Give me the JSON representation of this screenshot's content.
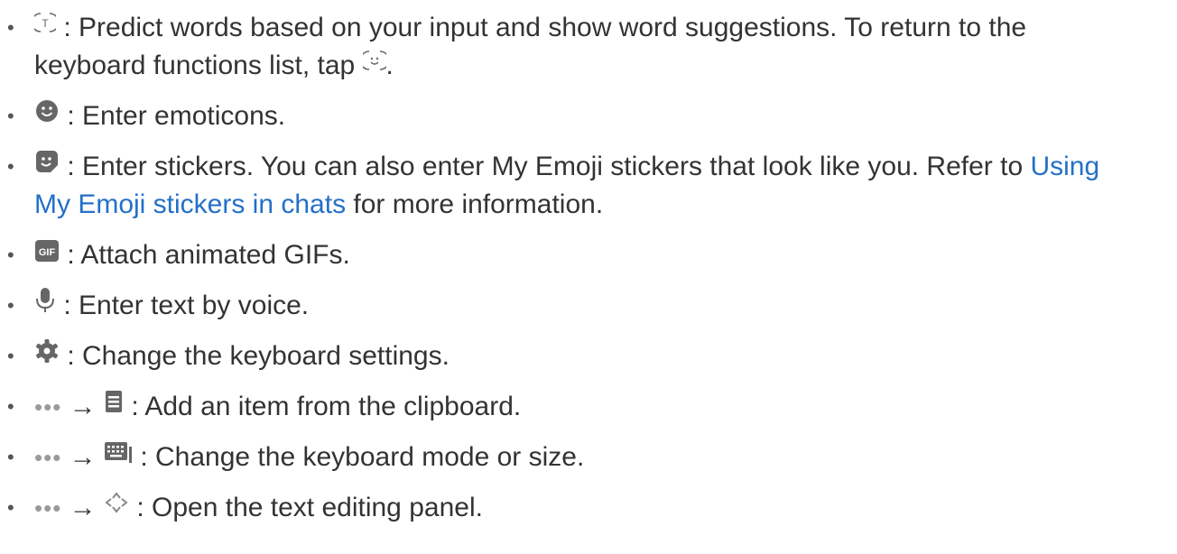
{
  "items": [
    {
      "key": "predict",
      "icon": "predictive-text-icon",
      "line1": ": Predict words based on your input and show word suggestions. To return to the",
      "line2_prefix": "keyboard functions list, tap ",
      "line2_suffix": ".",
      "tap_icon": "emoji-keyboard-return-icon"
    },
    {
      "key": "emoticons",
      "icon": "smiley-icon",
      "text": ": Enter emoticons."
    },
    {
      "key": "stickers",
      "icon": "sticker-icon",
      "text": ": Enter stickers. You can also enter My Emoji stickers that look like you. Refer to ",
      "link_a": "Using",
      "link_b": "My Emoji stickers in chats",
      "after": " for more information."
    },
    {
      "key": "gif",
      "icon": "gif-icon",
      "gif_label": "GIF",
      "text": ": Attach animated GIFs."
    },
    {
      "key": "voice",
      "icon": "microphone-icon",
      "text": ": Enter text by voice."
    },
    {
      "key": "settings",
      "icon": "gear-icon",
      "text": ": Change the keyboard settings."
    },
    {
      "key": "clipboard",
      "more": "•••",
      "arrow": "→",
      "icon": "clipboard-icon",
      "text": ": Add an item from the clipboard."
    },
    {
      "key": "mode",
      "more": "•••",
      "arrow": "→",
      "icon": "keyboard-mode-icon",
      "text": ": Change the keyboard mode or size."
    },
    {
      "key": "editing",
      "more": "•••",
      "arrow": "→",
      "icon": "text-editing-icon",
      "text": ": Open the text editing panel."
    }
  ]
}
